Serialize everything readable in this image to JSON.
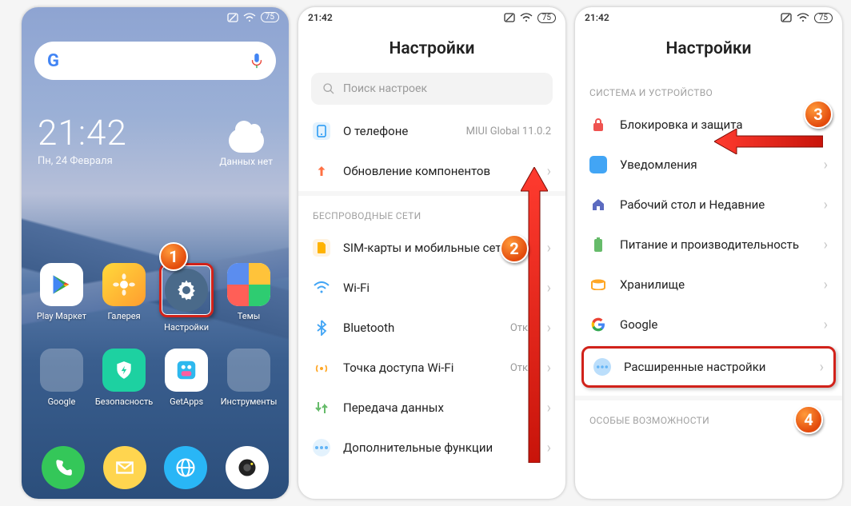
{
  "status": {
    "time": "21:42",
    "battery": "75"
  },
  "home": {
    "clock": {
      "time": "21:42",
      "date": "Пн, 24 Февраля"
    },
    "weather": {
      "label": "Данных нет"
    },
    "apps_row1": [
      {
        "label": "Play Маркет"
      },
      {
        "label": "Галерея"
      },
      {
        "label": "Настройки"
      },
      {
        "label": "Темы"
      }
    ],
    "apps_row2": [
      {
        "label": "Google"
      },
      {
        "label": "Безопасность"
      },
      {
        "label": "GetApps"
      },
      {
        "label": "Инструменты"
      }
    ]
  },
  "settings1": {
    "title": "Настройки",
    "search_placeholder": "Поиск настроек",
    "about": {
      "label": "О телефоне",
      "value": "MIUI Global 11.0.2"
    },
    "update": {
      "label": "Обновление компонентов"
    },
    "section_wireless": "БЕСПРОВОДНЫЕ СЕТИ",
    "items": [
      {
        "label": "SIM-карты и мобильные сети"
      },
      {
        "label": "Wi-Fi",
        "value": ""
      },
      {
        "label": "Bluetooth",
        "value": "Откл"
      },
      {
        "label": "Точка доступа Wi-Fi",
        "value": "Откл"
      },
      {
        "label": "Передача данных"
      },
      {
        "label": "Дополнительные функции"
      }
    ]
  },
  "settings2": {
    "title": "Настройки",
    "section_system": "СИСТЕМА И УСТРОЙСТВО",
    "items": [
      {
        "label": "Блокировка и защита"
      },
      {
        "label": "Уведомления"
      },
      {
        "label": "Рабочий стол и Недавние"
      },
      {
        "label": "Питание и производительность"
      },
      {
        "label": "Хранилище"
      },
      {
        "label": "Google"
      },
      {
        "label": "Расширенные настройки"
      }
    ],
    "section_special": "ОСОБЫЕ ВОЗМОЖНОСТИ"
  },
  "annotations": {
    "badge1": "1",
    "badge2": "2",
    "badge3": "3",
    "badge4": "4"
  }
}
